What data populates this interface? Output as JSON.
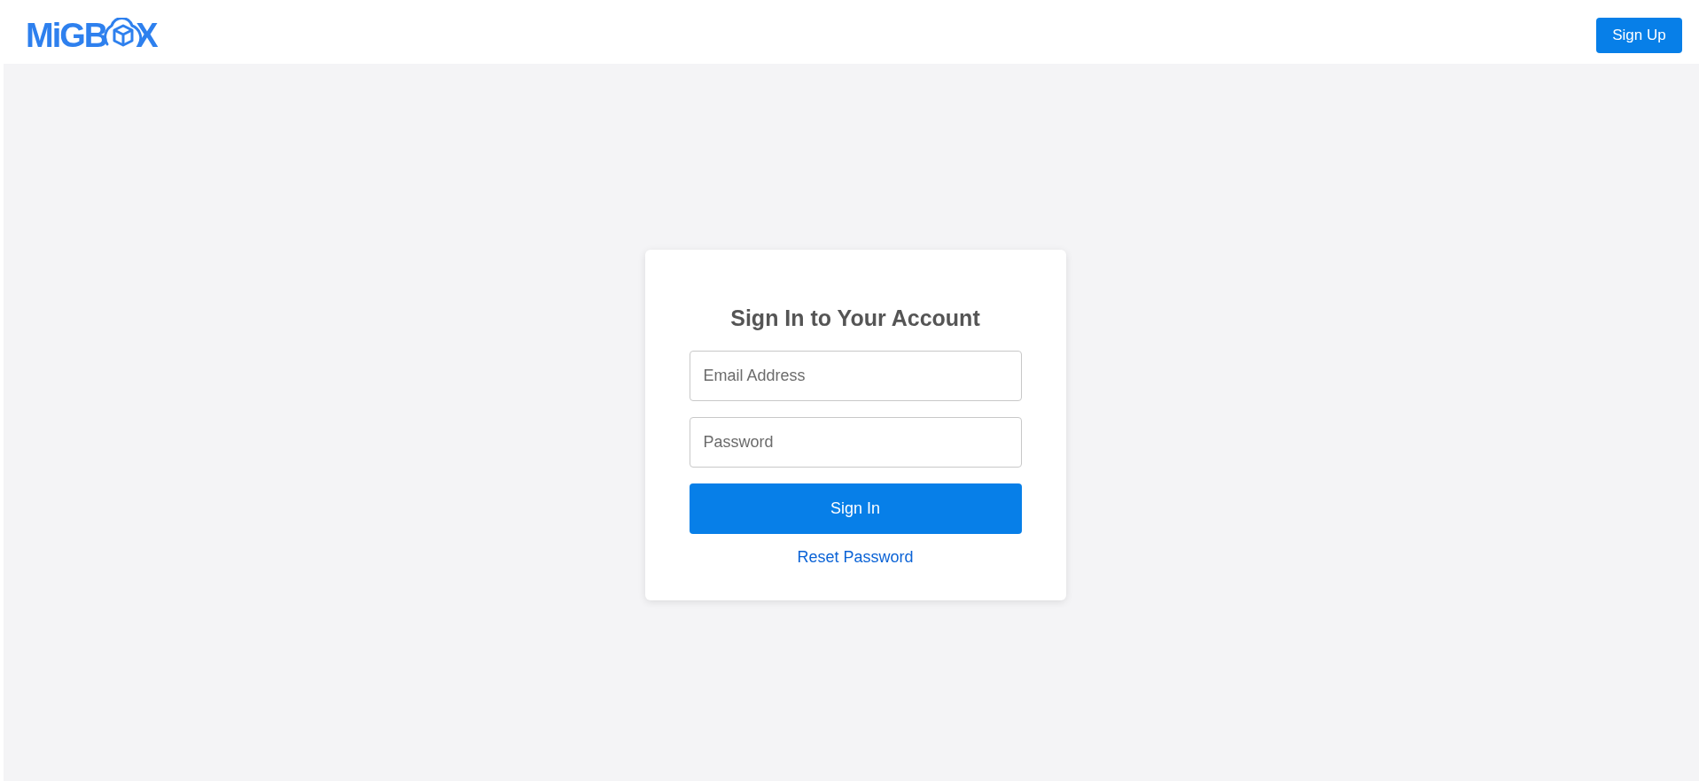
{
  "header": {
    "logo": {
      "prefix": "MiGB",
      "suffix": "X"
    },
    "signup_button": "Sign Up"
  },
  "login_card": {
    "title": "Sign In to Your Account",
    "fields": [
      {
        "placeholder": "Email Address"
      },
      {
        "placeholder": "Password"
      }
    ],
    "submit_button": "Sign In",
    "reset_link": "Reset Password"
  }
}
